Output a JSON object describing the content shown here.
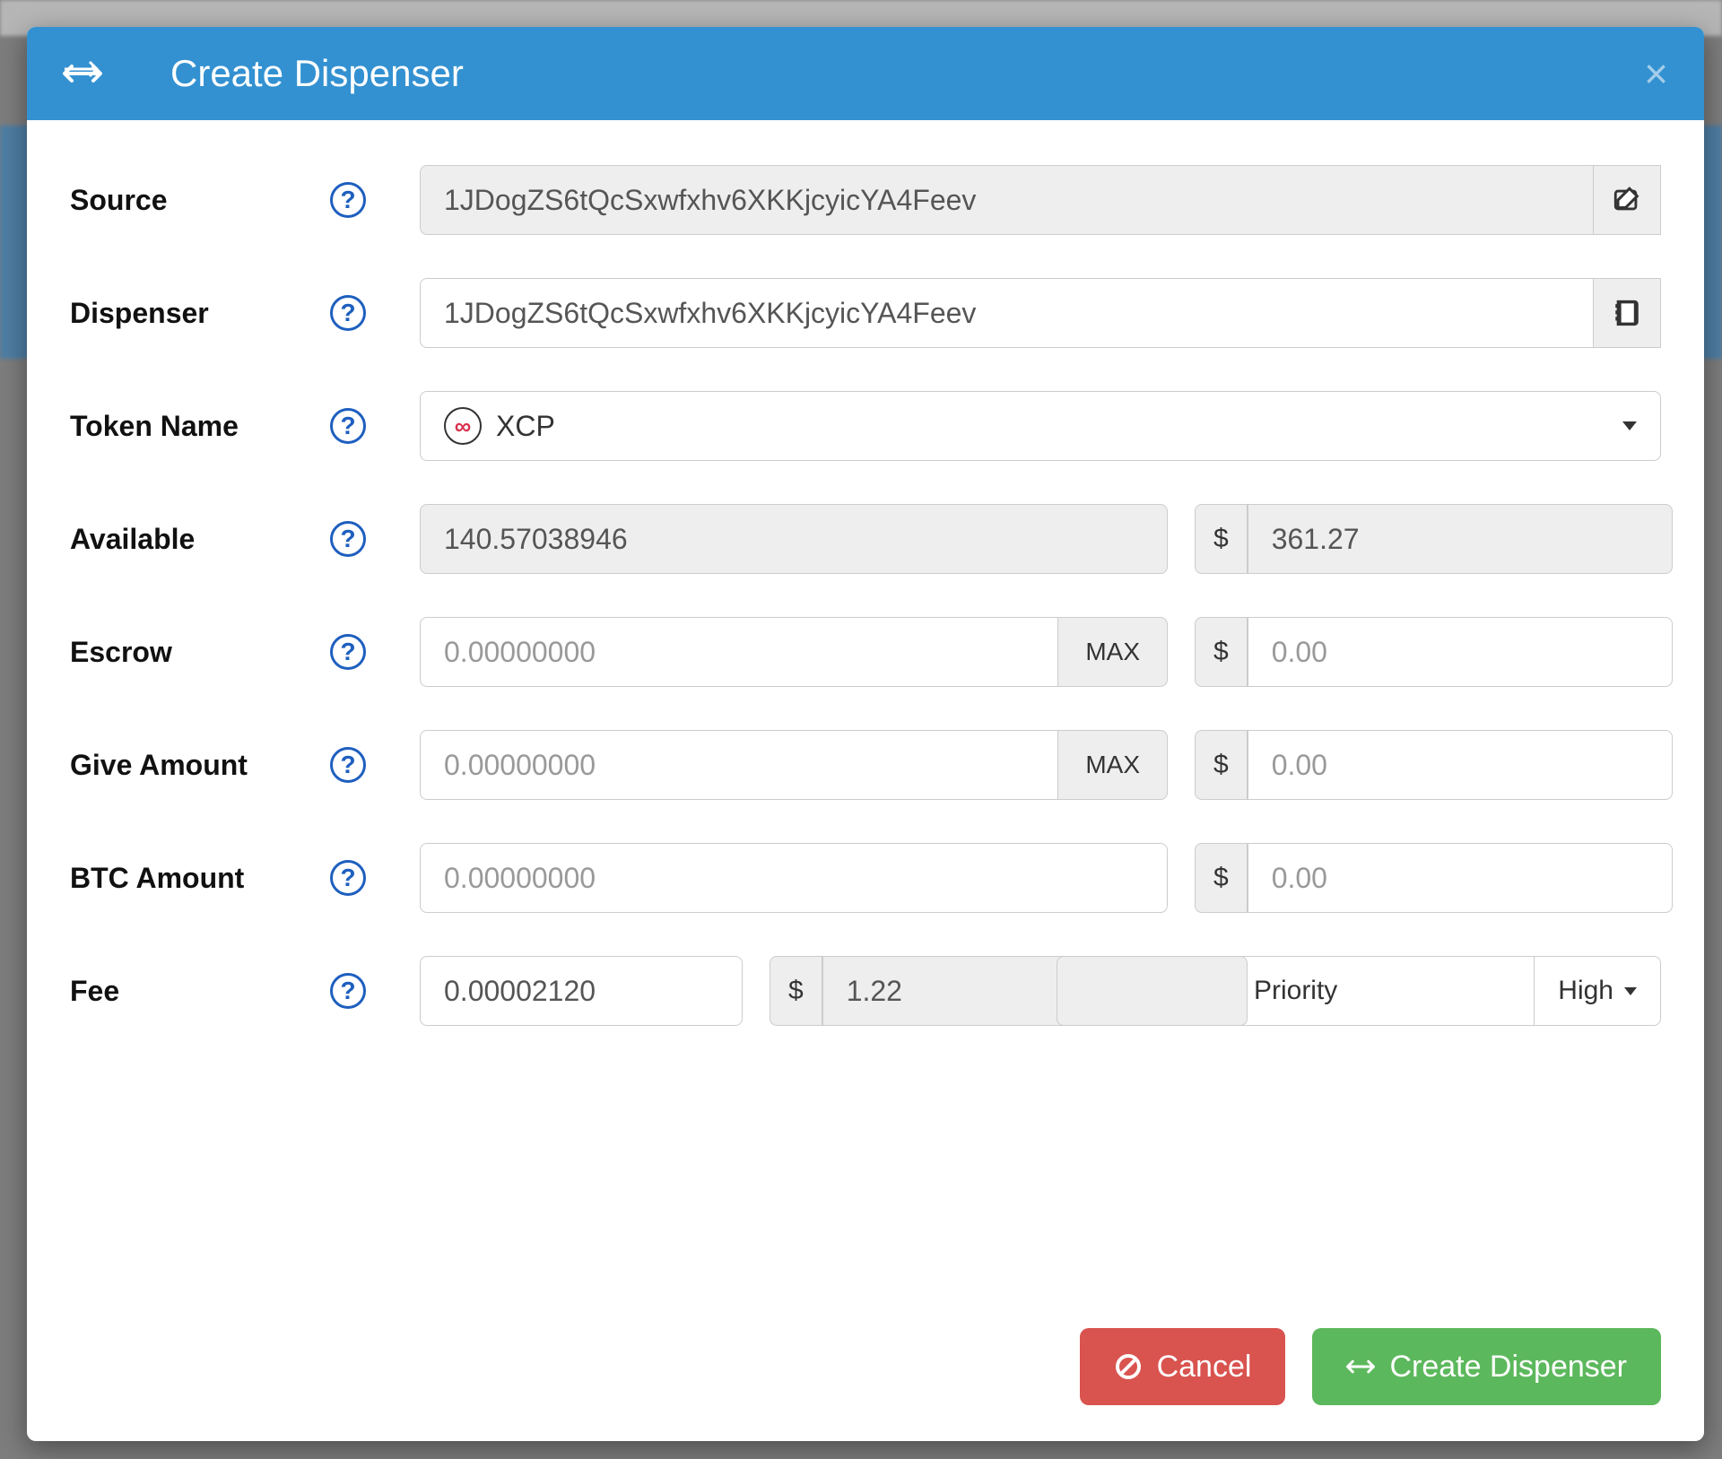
{
  "header": {
    "title": "Create Dispenser"
  },
  "form": {
    "source": {
      "label": "Source",
      "value": "1JDogZS6tQcSxwfxhv6XKKjcyicYA4Feev"
    },
    "dispenser": {
      "label": "Dispenser",
      "value": "1JDogZS6tQcSxwfxhv6XKKjcyicYA4Feev"
    },
    "token": {
      "label": "Token Name",
      "value": "XCP"
    },
    "available": {
      "label": "Available",
      "amount": "140.57038946",
      "usd": "361.27"
    },
    "escrow": {
      "label": "Escrow",
      "placeholder": "0.00000000",
      "usd_placeholder": "0.00",
      "max": "MAX"
    },
    "give": {
      "label": "Give Amount",
      "placeholder": "0.00000000",
      "usd_placeholder": "0.00",
      "max": "MAX"
    },
    "btc": {
      "label": "BTC Amount",
      "placeholder": "0.00000000",
      "usd_placeholder": "0.00"
    },
    "fee": {
      "label": "Fee",
      "amount": "0.00002120",
      "usd": "1.22",
      "priority_label": "Priority",
      "priority_value": "High"
    },
    "currency_symbol": "$"
  },
  "footer": {
    "cancel": "Cancel",
    "create": "Create Dispenser"
  }
}
